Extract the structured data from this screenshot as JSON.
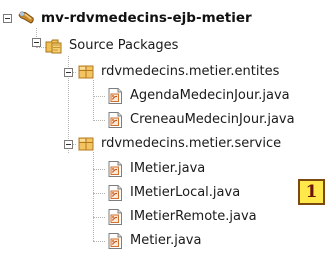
{
  "tree": {
    "project": {
      "label": "mv-rdvmedecins-ejb-metier",
      "icon": "maven-project-icon"
    },
    "source_packages": {
      "label": "Source Packages",
      "icon": "source-packages-icon"
    },
    "packages": [
      {
        "label": "rdvmedecins.metier.entites",
        "icon": "package-icon",
        "files": [
          {
            "label": "AgendaMedecinJour.java",
            "icon": "java-file-icon"
          },
          {
            "label": "CreneauMedecinJour.java",
            "icon": "java-file-icon"
          }
        ]
      },
      {
        "label": "rdvmedecins.metier.service",
        "icon": "package-icon",
        "files": [
          {
            "label": "IMetier.java",
            "icon": "java-file-icon"
          },
          {
            "label": "IMetierLocal.java",
            "icon": "java-file-icon"
          },
          {
            "label": "IMetierRemote.java",
            "icon": "java-file-icon"
          },
          {
            "label": "Metier.java",
            "icon": "java-file-icon"
          }
        ]
      }
    ]
  },
  "annotation": {
    "text": "1"
  },
  "colors": {
    "badge_background": "#ffe84a",
    "badge_border": "#7b4a10",
    "badge_text": "#6b1508",
    "package_icon": "#e8b04a",
    "java_icon_accent": "#d2702c"
  }
}
